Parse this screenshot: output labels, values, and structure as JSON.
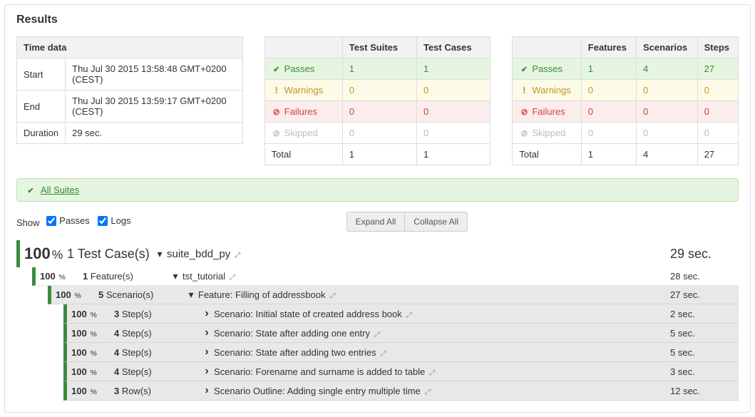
{
  "title": "Results",
  "timeTable": {
    "header": "Time data",
    "rows": [
      {
        "label": "Start",
        "value": "Thu Jul 30 2015 13:58:48 GMT+0200 (CEST)"
      },
      {
        "label": "End",
        "value": "Thu Jul 30 2015 13:59:17 GMT+0200 (CEST)"
      },
      {
        "label": "Duration",
        "value": "29 sec."
      }
    ]
  },
  "suitesTable": {
    "headers": [
      "",
      "Test Suites",
      "Test Cases"
    ],
    "rows": {
      "passes": {
        "label": "Passes",
        "v1": "1",
        "v2": "1"
      },
      "warnings": {
        "label": "Warnings",
        "v1": "0",
        "v2": "0"
      },
      "failures": {
        "label": "Failures",
        "v1": "0",
        "v2": "0"
      },
      "skipped": {
        "label": "Skipped",
        "v1": "0",
        "v2": "0"
      },
      "total": {
        "label": "Total",
        "v1": "1",
        "v2": "1"
      }
    }
  },
  "featuresTable": {
    "headers": [
      "",
      "Features",
      "Scenarios",
      "Steps"
    ],
    "rows": {
      "passes": {
        "label": "Passes",
        "v1": "1",
        "v2": "4",
        "v3": "27"
      },
      "warnings": {
        "label": "Warnings",
        "v1": "0",
        "v2": "0",
        "v3": "0"
      },
      "failures": {
        "label": "Failures",
        "v1": "0",
        "v2": "0",
        "v3": "0"
      },
      "skipped": {
        "label": "Skipped",
        "v1": "0",
        "v2": "0",
        "v3": "0"
      },
      "total": {
        "label": "Total",
        "v1": "1",
        "v2": "4",
        "v3": "27"
      }
    }
  },
  "banner": {
    "link": "All Suites"
  },
  "controls": {
    "showLabel": "Show",
    "passesLabel": "Passes",
    "logsLabel": "Logs",
    "expandAll": "Expand All",
    "collapseAll": "Collapse All"
  },
  "tree": {
    "root": {
      "pct": "100",
      "countNum": "1",
      "countLabel": " Test Case(s)",
      "title": "suite_bdd_py",
      "time": "29 sec."
    },
    "l1": {
      "pct": "100",
      "countNum": "1",
      "countLabel": " Feature(s)",
      "title": "tst_tutorial",
      "time": "28 sec."
    },
    "l2": {
      "pct": "100",
      "countNum": "5",
      "countLabel": " Scenario(s)",
      "title": "Feature: Filling of addressbook",
      "time": "27 sec."
    },
    "scenarios": [
      {
        "pct": "100",
        "countNum": "3",
        "countLabel": " Step(s)",
        "title": "Scenario: Initial state of created address book",
        "time": "2 sec."
      },
      {
        "pct": "100",
        "countNum": "4",
        "countLabel": " Step(s)",
        "title": "Scenario: State after adding one entry",
        "time": "5 sec."
      },
      {
        "pct": "100",
        "countNum": "4",
        "countLabel": " Step(s)",
        "title": "Scenario: State after adding two entries",
        "time": "5 sec."
      },
      {
        "pct": "100",
        "countNum": "4",
        "countLabel": " Step(s)",
        "title": "Scenario: Forename and surname is added to table",
        "time": "3 sec."
      },
      {
        "pct": "100",
        "countNum": "3",
        "countLabel": " Row(s)",
        "title": "Scenario Outline: Adding single entry multiple time",
        "time": "12 sec."
      }
    ]
  }
}
